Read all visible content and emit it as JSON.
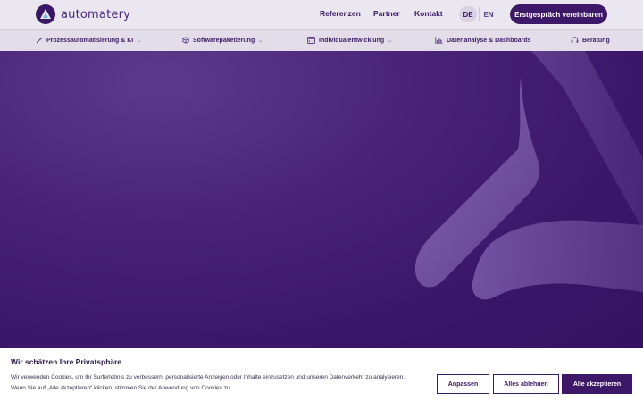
{
  "header": {
    "logo_text": "automatery",
    "nav": [
      "Referenzen",
      "Partner",
      "Kontakt"
    ],
    "lang_de": "DE",
    "lang_en": "EN",
    "cta": "Erstgespräch vereinbaren"
  },
  "subnav": [
    {
      "label": "Prozessautomatisierung & KI",
      "icon": "wand-icon",
      "dropdown": true
    },
    {
      "label": "Softwarepaketierung",
      "icon": "package-icon",
      "dropdown": true
    },
    {
      "label": "Individualentwicklung",
      "icon": "code-window-icon",
      "dropdown": true
    },
    {
      "label": "Datenanalyse & Dashboards",
      "icon": "chart-icon",
      "dropdown": false
    },
    {
      "label": "Beratung",
      "icon": "headset-icon",
      "dropdown": false
    }
  ],
  "cookie": {
    "title": "Wir schätzen Ihre Privatsphäre",
    "text_line1": "Wir verwenden Cookies, um Ihr Surferlebnis zu verbessern, personalisierte Anzeigen oder Inhalte einzusetzen und unseren Datenverkehr zu analysieren.",
    "text_line2": "Wenn Sie auf „Alle akzeptieren“ klicken, stimmen Sie der Anwendung von Cookies zu.",
    "btn_customize": "Anpassen",
    "btn_reject": "Alles ablehnen",
    "btn_accept": "Alle akzeptieren"
  },
  "colors": {
    "brand_dark": "#3d1768",
    "header_bg": "#ebe7f0",
    "hero_bg": "#3f1a6c"
  }
}
